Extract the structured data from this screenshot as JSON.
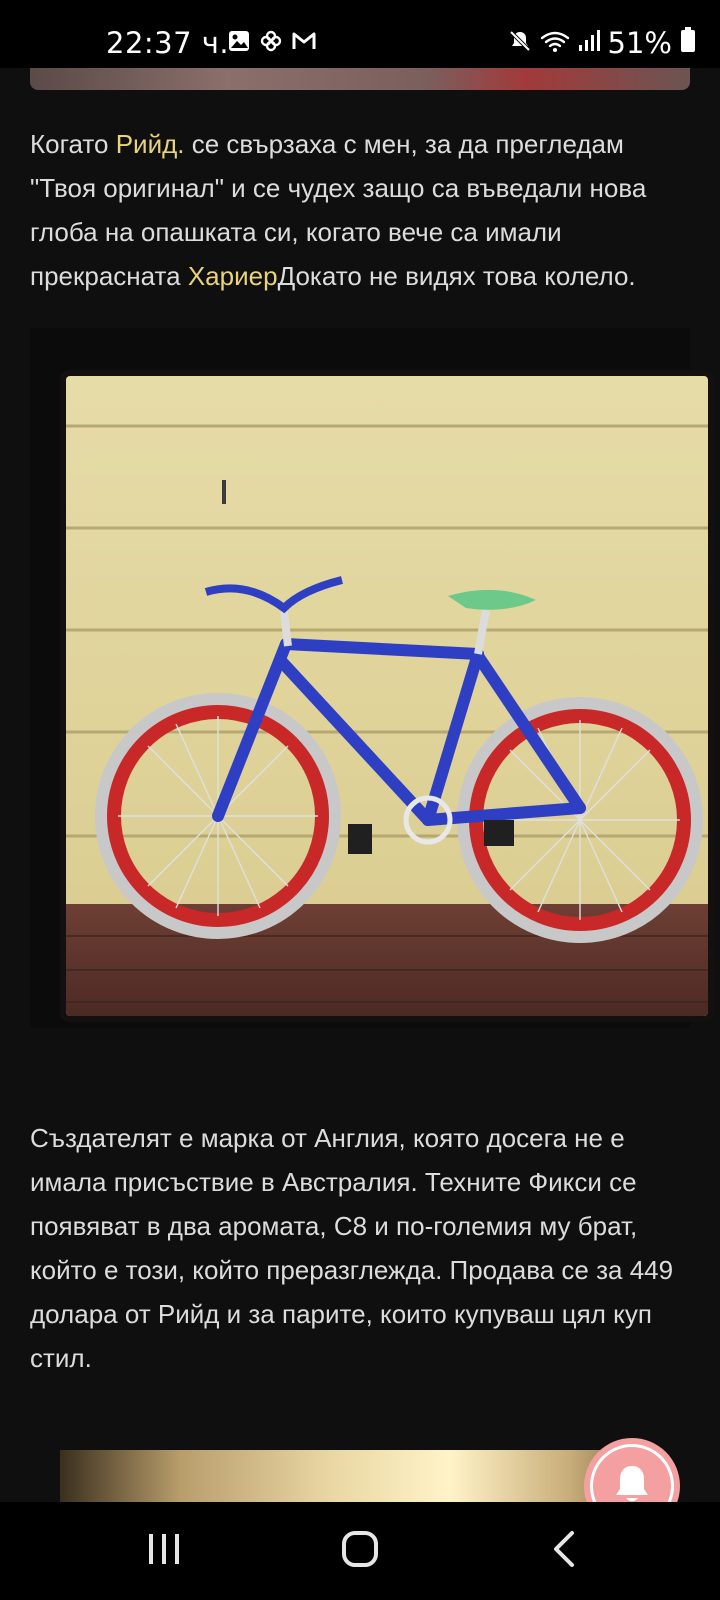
{
  "status_bar": {
    "time": "22:37 ч.",
    "battery": "51%"
  },
  "article": {
    "para1": {
      "t1": "Когато ",
      "link1": "Рийд.",
      "t2": " се свързаха с мен, за да прегледам \"Твоя оригинал\" и се чудех защо са въведали нова глоба на опашката си, когато вече са имали прекрасната ",
      "link2": "Хариер",
      "t3": "Докато не видях това колело."
    },
    "para2": "Създателят е марка от Англия, която досега не е имала присъствие в Австралия. Техните Фикси се появяват в два аромата, С8 и по-големия му брат, който е този, който преразглежда. Продава се за 449 долара от Рийд и за парите, които купуваш цял куп стил."
  },
  "icons": {
    "status_left": [
      "gallery-icon",
      "pinwheel-icon",
      "gmail-icon"
    ],
    "status_right": [
      "mute-icon",
      "wifi-icon",
      "signal-icon",
      "battery-icon"
    ],
    "floating": "notification-bell-icon",
    "nav": [
      "recents-icon",
      "home-icon",
      "back-icon"
    ]
  },
  "colors": {
    "background": "#0f0f0f",
    "link": "#e8d27a",
    "notification_button": "#f5a0a0"
  }
}
